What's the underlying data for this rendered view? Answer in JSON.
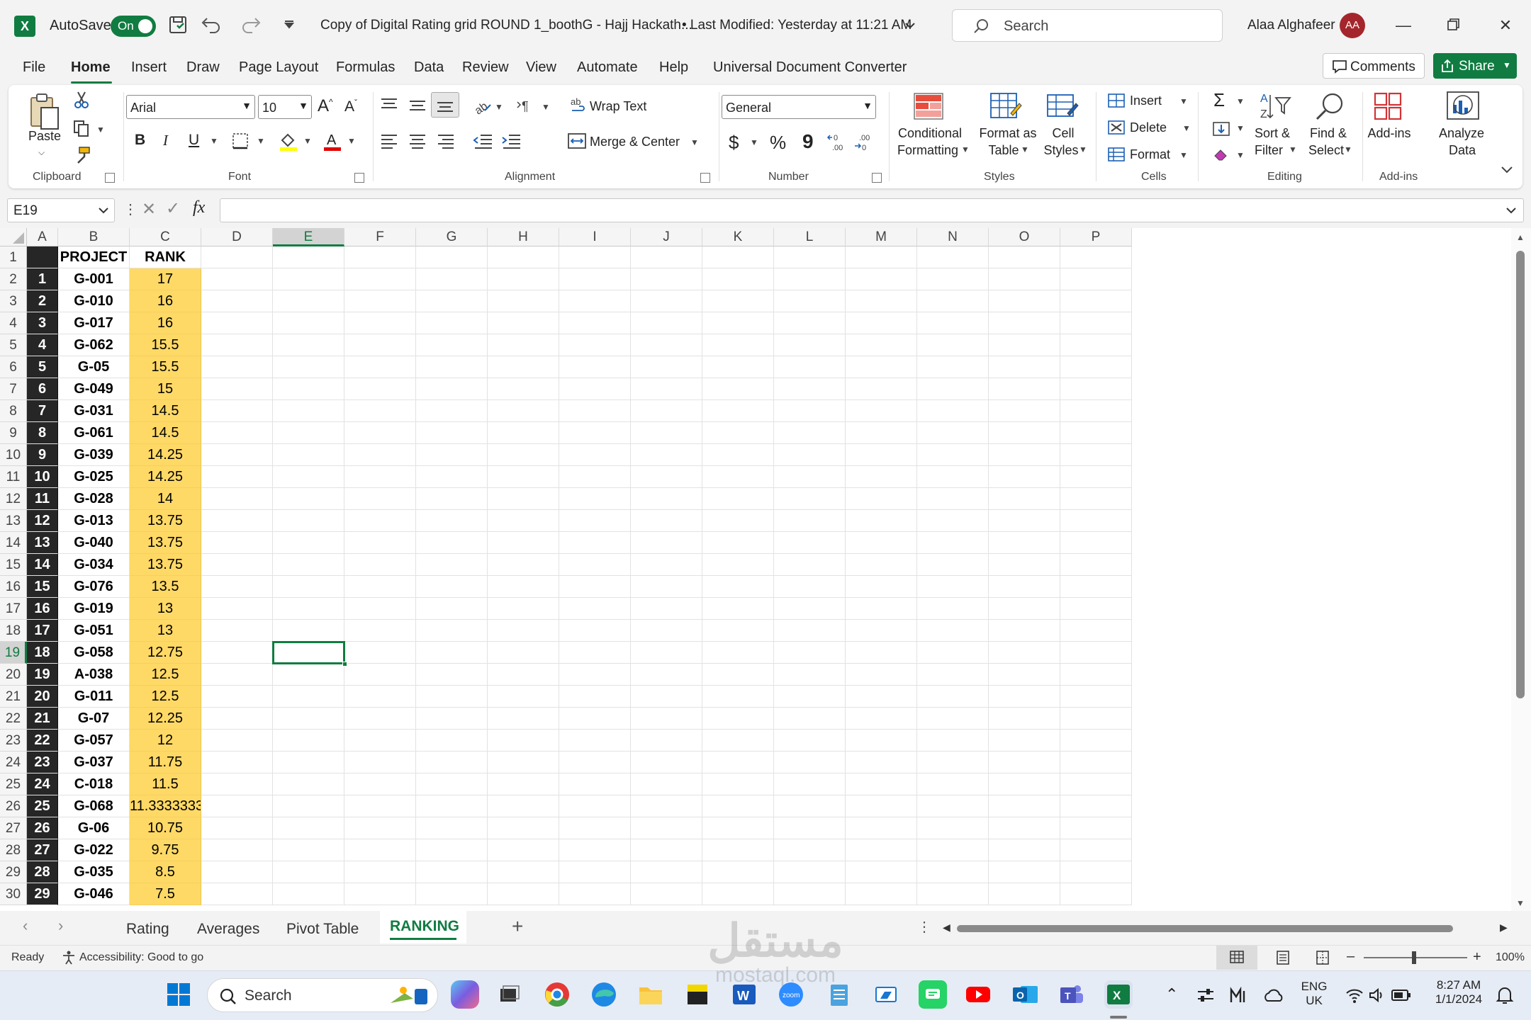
{
  "titlebar": {
    "app_logo": "X",
    "autosave_label": "AutoSave",
    "autosave_state": "On",
    "document_title": "Copy of Digital Rating grid ROUND 1_boothG - Hajj Hackath...",
    "last_modified": "• Last Modified: Yesterday at 11:21 AM",
    "search_placeholder": "Search",
    "user_name": "Alaa Alghafeer",
    "user_initials": "AA"
  },
  "menu": {
    "items": [
      "File",
      "Home",
      "Insert",
      "Draw",
      "Page Layout",
      "Formulas",
      "Data",
      "Review",
      "View",
      "Automate",
      "Help",
      "Universal Document Converter"
    ],
    "active": "Home",
    "comments_label": "Comments",
    "share_label": "Share"
  },
  "ribbon": {
    "clipboard": {
      "label": "Clipboard",
      "paste": "Paste"
    },
    "font": {
      "label": "Font",
      "family": "Arial",
      "size": "10",
      "bold": "B",
      "italic": "I",
      "underline": "U"
    },
    "alignment": {
      "label": "Alignment",
      "wrap_text": "Wrap Text",
      "merge_center": "Merge & Center"
    },
    "number": {
      "label": "Number",
      "format": "General",
      "currency": "$",
      "percent": "%",
      "comma": "9"
    },
    "styles": {
      "label": "Styles",
      "conditional_1": "Conditional",
      "conditional_2": "Formatting",
      "format_table_1": "Format as",
      "format_table_2": "Table",
      "cell_styles_1": "Cell",
      "cell_styles_2": "Styles"
    },
    "cells": {
      "label": "Cells",
      "insert": "Insert",
      "delete": "Delete",
      "format": "Format"
    },
    "editing": {
      "label": "Editing",
      "sort_1": "Sort &",
      "sort_2": "Filter",
      "find_1": "Find &",
      "find_2": "Select"
    },
    "addins": {
      "label": "Add-ins",
      "addins_btn": "Add-ins",
      "analyze_1": "Analyze",
      "analyze_2": "Data"
    }
  },
  "formula_bar": {
    "name_box": "E19",
    "fx": "fx",
    "formula": ""
  },
  "grid": {
    "columns": [
      "A",
      "B",
      "C",
      "D",
      "E",
      "F",
      "G",
      "H",
      "I",
      "J",
      "K",
      "L",
      "M",
      "N",
      "O",
      "P"
    ],
    "selected_column": "E",
    "selected_row": 19,
    "header_row": {
      "project": "PROJECT",
      "rank": "RANK"
    },
    "rows": [
      {
        "row": "2",
        "a": "1",
        "b": "G-001",
        "c": "17"
      },
      {
        "row": "3",
        "a": "2",
        "b": "G-010",
        "c": "16"
      },
      {
        "row": "4",
        "a": "3",
        "b": "G-017",
        "c": "16"
      },
      {
        "row": "5",
        "a": "4",
        "b": "G-062",
        "c": "15.5"
      },
      {
        "row": "6",
        "a": "5",
        "b": "G-05",
        "c": "15.5"
      },
      {
        "row": "7",
        "a": "6",
        "b": "G-049",
        "c": "15"
      },
      {
        "row": "8",
        "a": "7",
        "b": "G-031",
        "c": "14.5"
      },
      {
        "row": "9",
        "a": "8",
        "b": "G-061",
        "c": "14.5"
      },
      {
        "row": "10",
        "a": "9",
        "b": "G-039",
        "c": "14.25"
      },
      {
        "row": "11",
        "a": "10",
        "b": "G-025",
        "c": "14.25"
      },
      {
        "row": "12",
        "a": "11",
        "b": "G-028",
        "c": "14"
      },
      {
        "row": "13",
        "a": "12",
        "b": "G-013",
        "c": "13.75"
      },
      {
        "row": "14",
        "a": "13",
        "b": "G-040",
        "c": "13.75"
      },
      {
        "row": "15",
        "a": "14",
        "b": "G-034",
        "c": "13.75"
      },
      {
        "row": "16",
        "a": "15",
        "b": "G-076",
        "c": "13.5"
      },
      {
        "row": "17",
        "a": "16",
        "b": "G-019",
        "c": "13"
      },
      {
        "row": "18",
        "a": "17",
        "b": "G-051",
        "c": "13"
      },
      {
        "row": "19",
        "a": "18",
        "b": "G-058",
        "c": "12.75"
      },
      {
        "row": "20",
        "a": "19",
        "b": "A-038",
        "c": "12.5"
      },
      {
        "row": "21",
        "a": "20",
        "b": "G-011",
        "c": "12.5"
      },
      {
        "row": "22",
        "a": "21",
        "b": "G-07",
        "c": "12.25"
      },
      {
        "row": "23",
        "a": "22",
        "b": "G-057",
        "c": "12"
      },
      {
        "row": "24",
        "a": "23",
        "b": "G-037",
        "c": "11.75"
      },
      {
        "row": "25",
        "a": "24",
        "b": "C-018",
        "c": "11.5"
      },
      {
        "row": "26",
        "a": "25",
        "b": "G-068",
        "c": "11.33333333"
      },
      {
        "row": "27",
        "a": "26",
        "b": "G-06",
        "c": "10.75"
      },
      {
        "row": "28",
        "a": "27",
        "b": "G-022",
        "c": "9.75"
      },
      {
        "row": "29",
        "a": "28",
        "b": "G-035",
        "c": "8.5"
      },
      {
        "row": "30",
        "a": "29",
        "b": "G-046",
        "c": "7.5"
      }
    ]
  },
  "sheets": {
    "tabs": [
      "Rating",
      "Averages",
      "Pivot Table",
      "RANKING"
    ],
    "active": "RANKING"
  },
  "status": {
    "ready": "Ready",
    "accessibility": "Accessibility: Good to go",
    "zoom": "100%"
  },
  "taskbar": {
    "search_label": "Search",
    "language_1": "ENG",
    "language_2": "UK",
    "time": "8:27 AM",
    "date": "1/1/2024"
  },
  "watermark": {
    "text_1": "مستقل",
    "text_2": "mostaql.com"
  },
  "colors": {
    "accent": "#107c41",
    "rank_fill": "#ffd966",
    "index_fill": "#262626"
  }
}
